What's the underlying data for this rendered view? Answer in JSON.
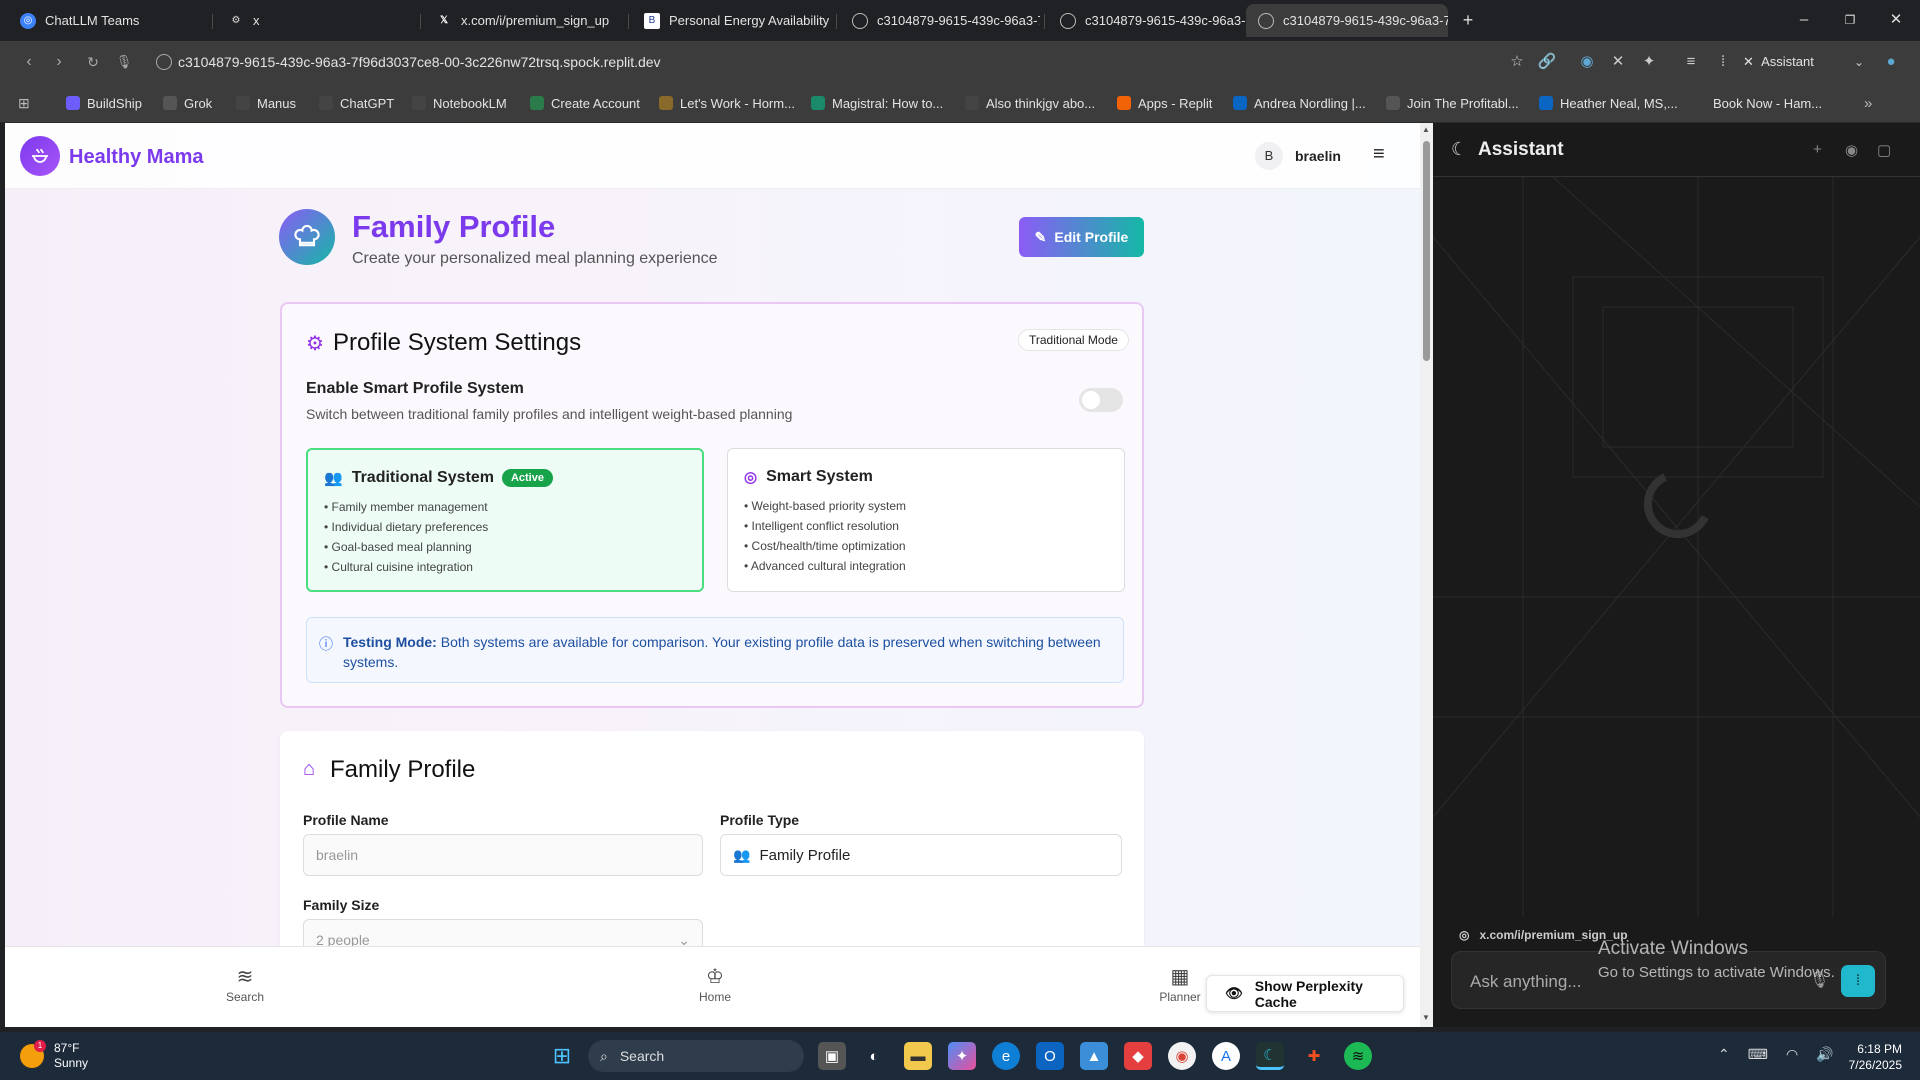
{
  "browser": {
    "tabs": [
      {
        "label": "ChatLLM Teams",
        "icon": "chatllm-icon"
      },
      {
        "label": "x",
        "icon": "settings-icon"
      },
      {
        "label": "x.com/i/premium_sign_up",
        "icon": "x-logo-icon"
      },
      {
        "label": "Personal Energy Availability C",
        "icon": "doc-icon"
      },
      {
        "label": "c3104879-9615-439c-96a3-7",
        "icon": "globe-icon"
      },
      {
        "label": "c3104879-9615-439c-96a3-7",
        "icon": "globe-icon"
      },
      {
        "label": "c3104879-9615-439c-96a3-7",
        "icon": "globe-icon"
      }
    ],
    "url": "c3104879-9615-439c-96a3-7f96d3037ce8-00-3c226nw72trsq.spock.replit.dev",
    "assistant_label": "Assistant",
    "bookmarks": [
      {
        "label": "BuildShip",
        "color": "#6d5dfc"
      },
      {
        "label": "Grok",
        "color": "#555555"
      },
      {
        "label": "Manus",
        "color": "#444444"
      },
      {
        "label": "ChatGPT",
        "color": "#444444"
      },
      {
        "label": "NotebookLM",
        "color": "#444444"
      },
      {
        "label": "Create Account",
        "color": "#2a7a4a"
      },
      {
        "label": "Let's Work - Horm...",
        "color": "#8a6a2a"
      },
      {
        "label": "Magistral: How to...",
        "color": "#1a8a6a"
      },
      {
        "label": "Also thinkjgv abo...",
        "color": "#444444"
      },
      {
        "label": "Apps - Replit",
        "color": "#f26207"
      },
      {
        "label": "Andrea Nordling |...",
        "color": "#0a66c2"
      },
      {
        "label": "Join The Profitabl...",
        "color": "#555555"
      },
      {
        "label": "Heather Neal, MS,...",
        "color": "#0a66c2"
      },
      {
        "label": "Book Now - Ham...",
        "color": "#3c3c3c"
      }
    ]
  },
  "app": {
    "brand": "Healthy Mama",
    "user_initial": "B",
    "username": "braelin",
    "page_title": "Family Profile",
    "page_subtitle": "Create your personalized meal planning experience",
    "edit_button": "Edit Profile"
  },
  "settings": {
    "title": "Profile System Settings",
    "mode_badge": "Traditional Mode",
    "toggle_label": "Enable Smart Profile System",
    "toggle_desc": "Switch between traditional family profiles and intelligent weight-based planning",
    "toggle_on": false,
    "traditional": {
      "title": "Traditional System",
      "badge": "Active",
      "features": [
        "• Family member management",
        "• Individual dietary preferences",
        "• Goal-based meal planning",
        "• Cultural cuisine integration"
      ]
    },
    "smart": {
      "title": "Smart System",
      "features": [
        "• Weight-based priority system",
        "• Intelligent conflict resolution",
        "• Cost/health/time optimization",
        "• Advanced cultural integration"
      ]
    },
    "testing_label": "Testing Mode:",
    "testing_text": "Both systems are available for comparison. Your existing profile data is preserved when switching between systems."
  },
  "profile": {
    "title": "Family Profile",
    "name_label": "Profile Name",
    "name_value": "braelin",
    "type_label": "Profile Type",
    "type_value": "Family Profile",
    "size_label": "Family Size",
    "size_value": "2 people"
  },
  "bottom_nav": {
    "search": "Search",
    "home": "Home",
    "planner": "Planner"
  },
  "cache_button": "Show Perplexity Cache",
  "assistant": {
    "title": "Assistant",
    "context_url": "x.com/i/premium_sign_up",
    "placeholder": "Ask anything..."
  },
  "watermark": {
    "title": "Activate Windows",
    "subtitle": "Go to Settings to activate Windows."
  },
  "taskbar": {
    "temp": "87°F",
    "condition": "Sunny",
    "weather_badge": "1",
    "search": "Search",
    "time": "6:18 PM",
    "date": "7/26/2025"
  },
  "colors": {
    "brand_purple": "#7c3aed",
    "accent_teal": "#14b8a6",
    "active_green": "#16a34a",
    "assistant_accent": "#20b8cd"
  }
}
